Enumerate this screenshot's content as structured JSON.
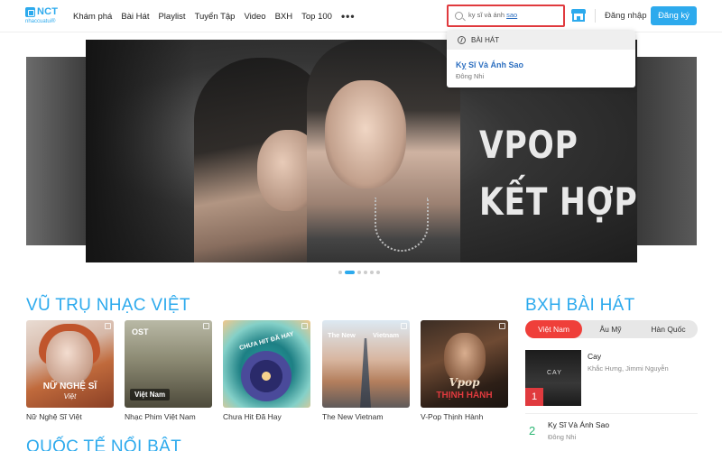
{
  "logo": {
    "brand": "NCT",
    "sub": "nhaccuatui®"
  },
  "nav": [
    "Khám phá",
    "Bài Hát",
    "Playlist",
    "Tuyển Tập",
    "Video",
    "BXH",
    "Top 100"
  ],
  "nav_more": "•••",
  "search": {
    "value_plain": "ky sĩ và ánh ",
    "value_underlined": "sao"
  },
  "auth": {
    "login": "Đăng nhập",
    "register": "Đăng ký"
  },
  "dropdown": {
    "section": "BÀI HÁT",
    "result_title": "Kỵ Sĩ Và Ánh Sao",
    "result_artist": "Đông Nhi"
  },
  "banner": {
    "line1": "VPOP",
    "line2": "KẾT HỢP",
    "slide_count": 6,
    "active_slide": 1
  },
  "sections": {
    "vietnam": "VŨ TRỤ NHẠC VIỆT",
    "international": "QUỐC TẾ NỔI BẬT",
    "chart": "BXH BÀI HÁT"
  },
  "cards": [
    {
      "label": "Nữ Nghệ Sĩ Việt",
      "overlay": "NỮ NGHỆ SĨ",
      "overlay_sub": "Việt"
    },
    {
      "label": "Nhạc Phim Việt Nam",
      "overlay_top": "OST",
      "overlay": "Việt Nam"
    },
    {
      "label": "Chưa Hit Đã Hay",
      "overlay": "CHƯA HIT ĐÃ HAY"
    },
    {
      "label": "The New Vietnam",
      "overlay_left": "The New",
      "overlay_right": "Vietnam"
    },
    {
      "label": "V-Pop Thịnh Hành",
      "overlay_script": "Vpop",
      "overlay": "THỊNH HÀNH"
    }
  ],
  "chart_tabs": [
    "Việt Nam",
    "Âu Mỹ",
    "Hàn Quốc"
  ],
  "chart_items": [
    {
      "rank": "1",
      "title": "Cay",
      "artist": "Khắc Hưng, Jimmi Nguyễn",
      "cover_text": "CAY"
    },
    {
      "rank": "2",
      "title": "Kỵ Sĩ Và Ánh Sao",
      "artist": "Đông Nhi"
    }
  ]
}
